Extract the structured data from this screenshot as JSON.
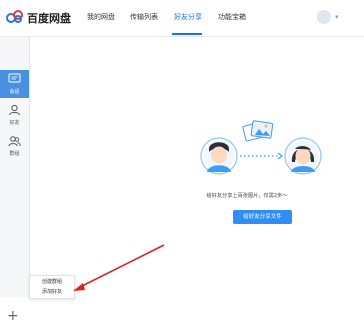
{
  "app": {
    "name": "百度网盘"
  },
  "nav": {
    "tabs": [
      {
        "label": "我的网盘"
      },
      {
        "label": "传输列表"
      },
      {
        "label": "好友分享"
      },
      {
        "label": "功能宝箱"
      }
    ],
    "active_index": 2
  },
  "sidebar": {
    "items": [
      {
        "label": "会话",
        "icon": "chat-icon"
      },
      {
        "label": "好友",
        "icon": "person-icon"
      },
      {
        "label": "群组",
        "icon": "group-icon"
      }
    ],
    "active_index": 0,
    "add_icon": "plus-icon"
  },
  "popup_menu": {
    "items": [
      {
        "label": "创建群组"
      },
      {
        "label": "添加好友"
      }
    ]
  },
  "main": {
    "hint": "给好友分享上百张图片，仅需2步～",
    "button_label": "给好友分享文件"
  },
  "colors": {
    "accent": "#1a73e8",
    "button": "#2f8df5",
    "arrow": "#e0201c"
  }
}
